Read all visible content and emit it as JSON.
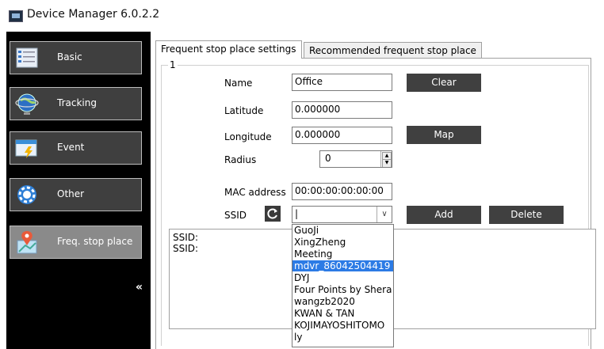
{
  "window": {
    "title": "Device Manager 6.0.2.2"
  },
  "sidebar": {
    "items": [
      {
        "label": "Basic",
        "icon": "basic-list-icon"
      },
      {
        "label": "Tracking",
        "icon": "tracking-globe-icon"
      },
      {
        "label": "Event",
        "icon": "event-icon"
      },
      {
        "label": "Other",
        "icon": "other-gear-icon"
      },
      {
        "label": "Freq. stop place",
        "icon": "map-pin-icon",
        "active": true
      }
    ],
    "collapse_glyph": "«"
  },
  "tabs": [
    {
      "label": "Frequent stop place settings",
      "active": true
    },
    {
      "label": "Recommended frequent stop place",
      "active": false
    }
  ],
  "form": {
    "group_title": "1",
    "name_label": "Name",
    "name_value": "Office",
    "latitude_label": "Latitude",
    "latitude_value": "0.000000",
    "longitude_label": "Longitude",
    "longitude_value": "0.000000",
    "radius_label": "Radius",
    "radius_value": "0",
    "mac_label": "MAC address",
    "mac_value": "00:00:00:00:00:00",
    "ssid_label": "SSID",
    "ssid_value": "|",
    "clear_button": "Clear",
    "map_button": "Map",
    "add_button": "Add",
    "delete_button": "Delete"
  },
  "ssid_list": [
    "SSID:",
    "SSID:"
  ],
  "dropdown": {
    "options": [
      "GuoJi",
      "XingZheng",
      "Meeting",
      "mdvr_86042504419",
      "DYJ",
      "Four Points by Shera",
      "wangzb2020",
      "KWAN & TAN",
      "KOJIMAYOSHITOMO",
      "ly"
    ],
    "selected_index": 3
  },
  "colors": {
    "sidebar_bg": "#000000",
    "nav_button": "#3f3f3f",
    "nav_active": "#8a8a8a",
    "dark_button": "#404040",
    "selection": "#2c7be5"
  }
}
